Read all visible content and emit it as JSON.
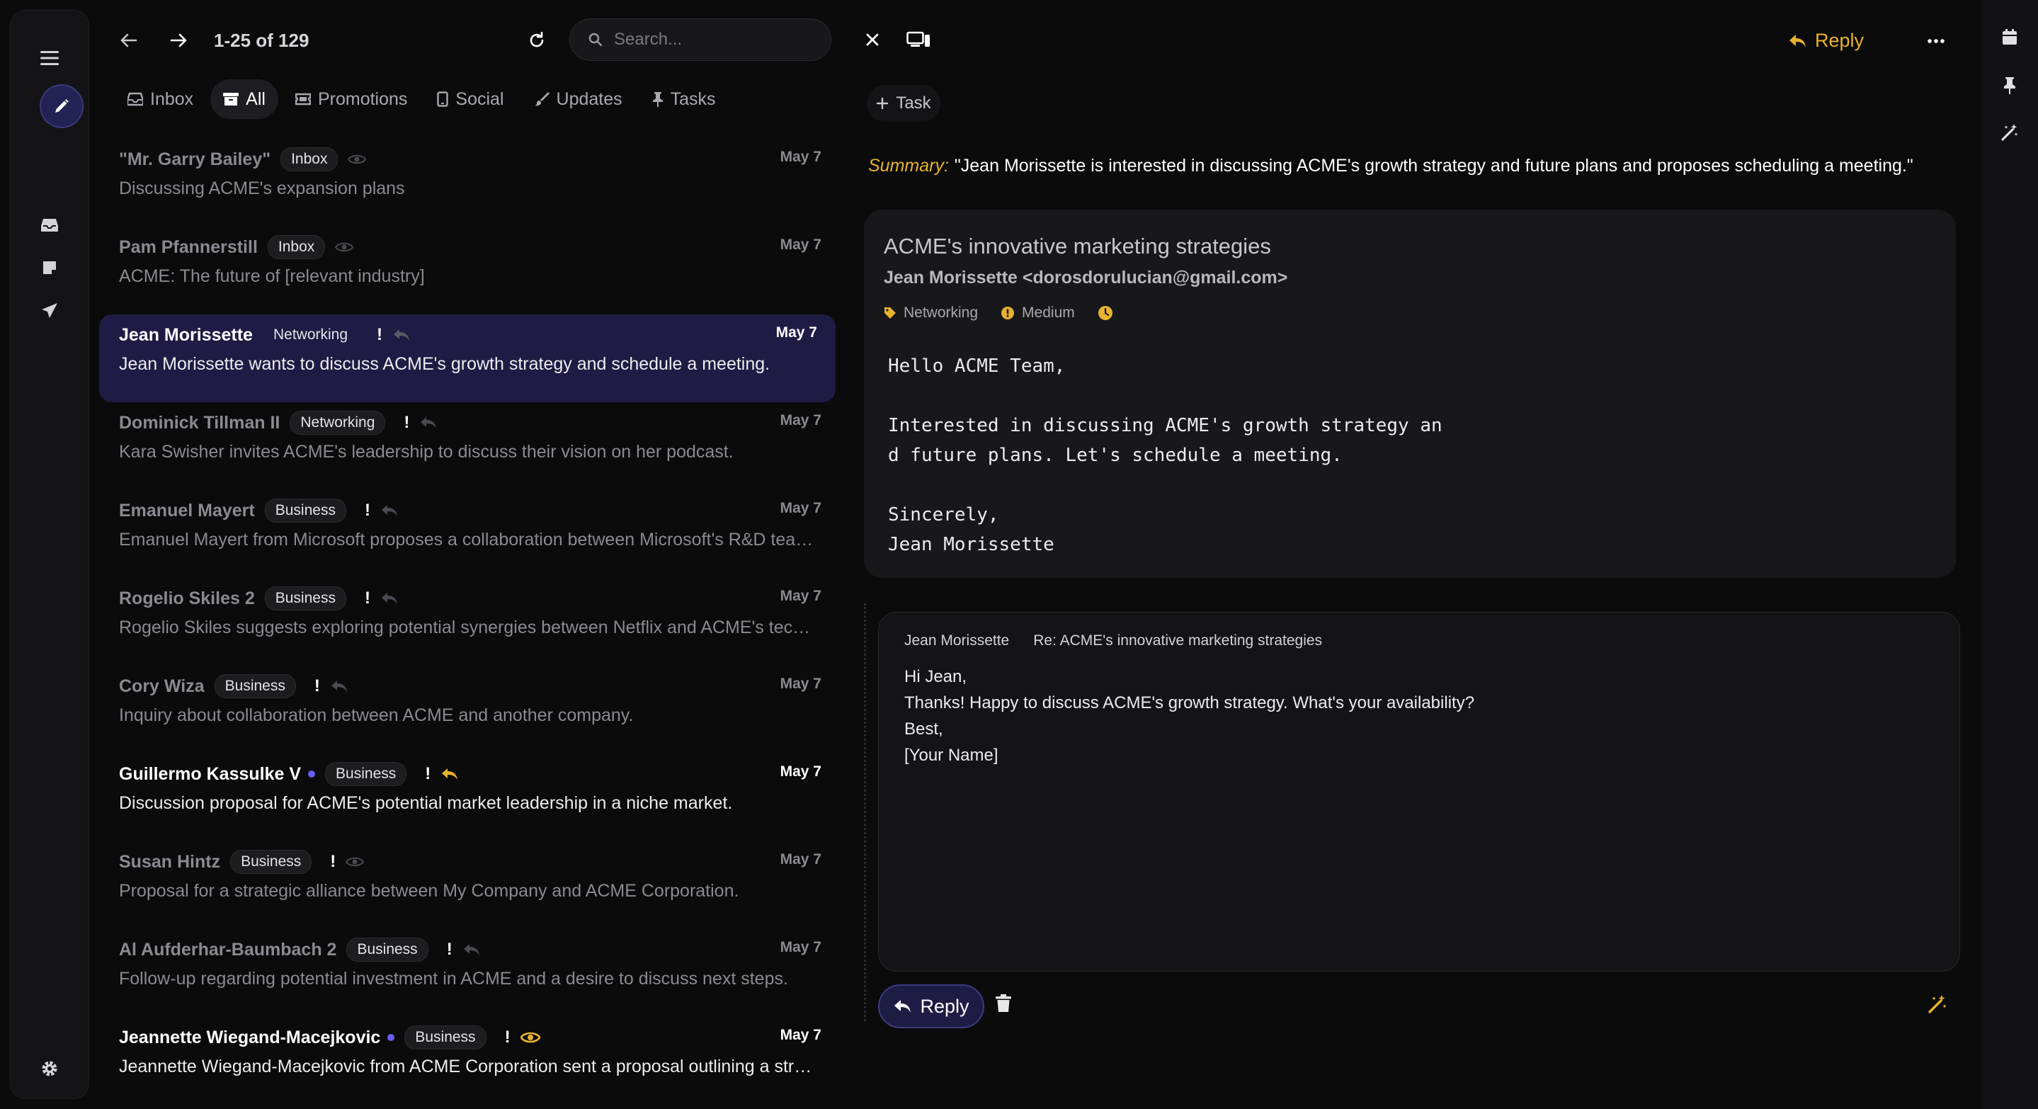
{
  "rail": {
    "icons": [
      "menu-icon",
      "compose-pencil-icon",
      "inbox-tray-icon",
      "notes-icon",
      "send-icon",
      "settings-gear-icon"
    ]
  },
  "list": {
    "count": "1-25 of 129",
    "search_placeholder": "Search...",
    "tabs": [
      {
        "label": "Inbox",
        "icon": "inbox-icon",
        "active": false
      },
      {
        "label": "All",
        "icon": "archive-icon",
        "active": true
      },
      {
        "label": "Promotions",
        "icon": "ticket-icon",
        "active": false
      },
      {
        "label": "Social",
        "icon": "phone-icon",
        "active": false
      },
      {
        "label": "Updates",
        "icon": "brush-icon",
        "active": false
      },
      {
        "label": "Tasks",
        "icon": "pin-icon",
        "active": false
      }
    ],
    "emails": [
      {
        "sender": "\"Mr. Garry Bailey\"",
        "label": "Inbox",
        "date": "May 7",
        "snippet": "Discussing ACME's expansion plans"
      },
      {
        "sender": "Pam Pfannerstill",
        "label": "Inbox",
        "date": "May 7",
        "snippet": "ACME: The future of [relevant industry]"
      },
      {
        "sender": "Jean Morissette",
        "label": "Networking",
        "date": "May 7",
        "snippet": "Jean Morissette wants to discuss ACME's growth strategy and schedule a meeting."
      },
      {
        "sender": "Dominick Tillman II",
        "label": "Networking",
        "date": "May 7",
        "snippet": "Kara Swisher invites ACME's leadership to discuss their vision on her podcast."
      },
      {
        "sender": "Emanuel Mayert",
        "label": "Business",
        "date": "May 7",
        "snippet": "Emanuel Mayert from Microsoft proposes a collaboration between Microsoft's R&D team..."
      },
      {
        "sender": "Rogelio Skiles 2",
        "label": "Business",
        "date": "May 7",
        "snippet": "Rogelio Skiles suggests exploring potential synergies between Netflix and ACME's technol..."
      },
      {
        "sender": "Cory Wiza",
        "label": "Business",
        "date": "May 7",
        "snippet": "Inquiry about collaboration between ACME and another company."
      },
      {
        "sender": "Guillermo Kassulke V",
        "label": "Business",
        "date": "May 7",
        "snippet": "Discussion proposal for ACME's potential market leadership in a niche market."
      },
      {
        "sender": "Susan Hintz",
        "label": "Business",
        "date": "May 7",
        "snippet": "Proposal for a strategic alliance between My Company and ACME Corporation."
      },
      {
        "sender": "Al Aufderhar-Baumbach 2",
        "label": "Business",
        "date": "May 7",
        "snippet": "Follow-up regarding potential investment in ACME and a desire to discuss next steps."
      },
      {
        "sender": "Jeannette Wiegand-Macejkovic",
        "label": "Business",
        "date": "May 7",
        "snippet": "Jeannette Wiegand-Macejkovic from ACME Corporation sent a proposal outlining a strate..."
      }
    ]
  },
  "reader": {
    "reply_label": "Reply",
    "task_label": "Task",
    "summary_key": "Summary:",
    "summary_text": "\"Jean Morissette is interested in discussing ACME's growth strategy and future plans and proposes scheduling a meeting.\"",
    "message": {
      "subject": "ACME's innovative marketing strategies",
      "from": "Jean Morissette <dorosdorulucian@gmail.com>",
      "tag": "Networking",
      "priority": "Medium",
      "body_lines": [
        "Hello ACME Team,",
        "",
        "Interested in discussing ACME's growth strategy an",
        "d future plans. Let's schedule a meeting.",
        "",
        "Sincerely,",
        "Jean Morissette"
      ]
    },
    "draft": {
      "to": "Jean Morissette",
      "subject": "Re: ACME's innovative marketing strategies",
      "lines": [
        "Hi Jean,",
        "Thanks! Happy to discuss ACME's growth strategy. What's your availability?",
        "Best,",
        "[Your Name]"
      ],
      "send_label": "Reply"
    }
  },
  "colors": {
    "accent_yellow": "#e8b22e",
    "selected_row": "#1e1c44",
    "unread_dot": "#6b5cf0"
  }
}
